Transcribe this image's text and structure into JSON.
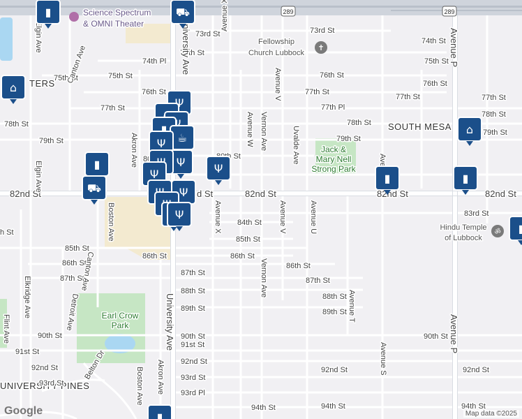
{
  "attribution": "Map data ©2025",
  "logo": "Google",
  "highway_shield": "289",
  "pois": {
    "science_spectrum": [
      "Science Spectrum",
      "& OMNI Theater"
    ],
    "fellowship_church": [
      "Fellowship",
      "Church Lubbock"
    ],
    "park": [
      "Jack &",
      "Mary Nell",
      "Strong Park"
    ],
    "hindu_temple": [
      "Hindu Temple",
      "of Lubbock"
    ],
    "earl_crow_park": [
      "Earl Crow",
      "Park"
    ],
    "south_mesa": "SOUTH MESA",
    "ters": "TERS",
    "university_pines": "UNIVERSITY PINES"
  },
  "streets": {
    "s73": "73rd St",
    "s74": "74th St",
    "s74pl": "74th Pl",
    "s75": "75th St",
    "s76": "76th St",
    "s77": "77th St",
    "s77pl": "77th Pl",
    "s78": "78th St",
    "s79": "79th St",
    "s80": "80th St",
    "s82": "82nd St",
    "s83": "83rd St",
    "s84": "84th St",
    "s85": "85th St",
    "s86": "86th St",
    "s87": "87th St",
    "s88": "88th St",
    "s89": "89th St",
    "s90": "90th St",
    "s91": "91st St",
    "s92": "92nd St",
    "s93": "93rd St",
    "s93pl": "93rd Pl",
    "s94": "94th St",
    "h": "h St",
    "d": "d St",
    "s80partial": "80",
    "university": "University Ave",
    "akron": "Akron Ave",
    "boston": "Boston Ave",
    "canton": "Canton Ave",
    "detroit": "Detroit Ave",
    "elkridge": "Elkridge Ave",
    "elgin": "Elgin Ave",
    "flint": "Flint Ave",
    "belton": "Belton Dr",
    "avex": "Avenue X",
    "avew": "Avenue W",
    "avev": "Avenue V",
    "vernon": "Vernon Ave",
    "uvalde": "Uvalde Ave",
    "aveu": "Avenue U",
    "avet": "Avenue T",
    "aves": "Avenue S",
    "avep": "Avenue P",
    "avepartial": "Ave"
  },
  "markers": [
    {
      "icon": "shopping-cart-icon"
    },
    {
      "icon": "shopping-bag-icon"
    },
    {
      "icon": "school-icon"
    },
    {
      "icon": "restaurant-icon"
    },
    {
      "icon": "cafe-icon"
    }
  ]
}
